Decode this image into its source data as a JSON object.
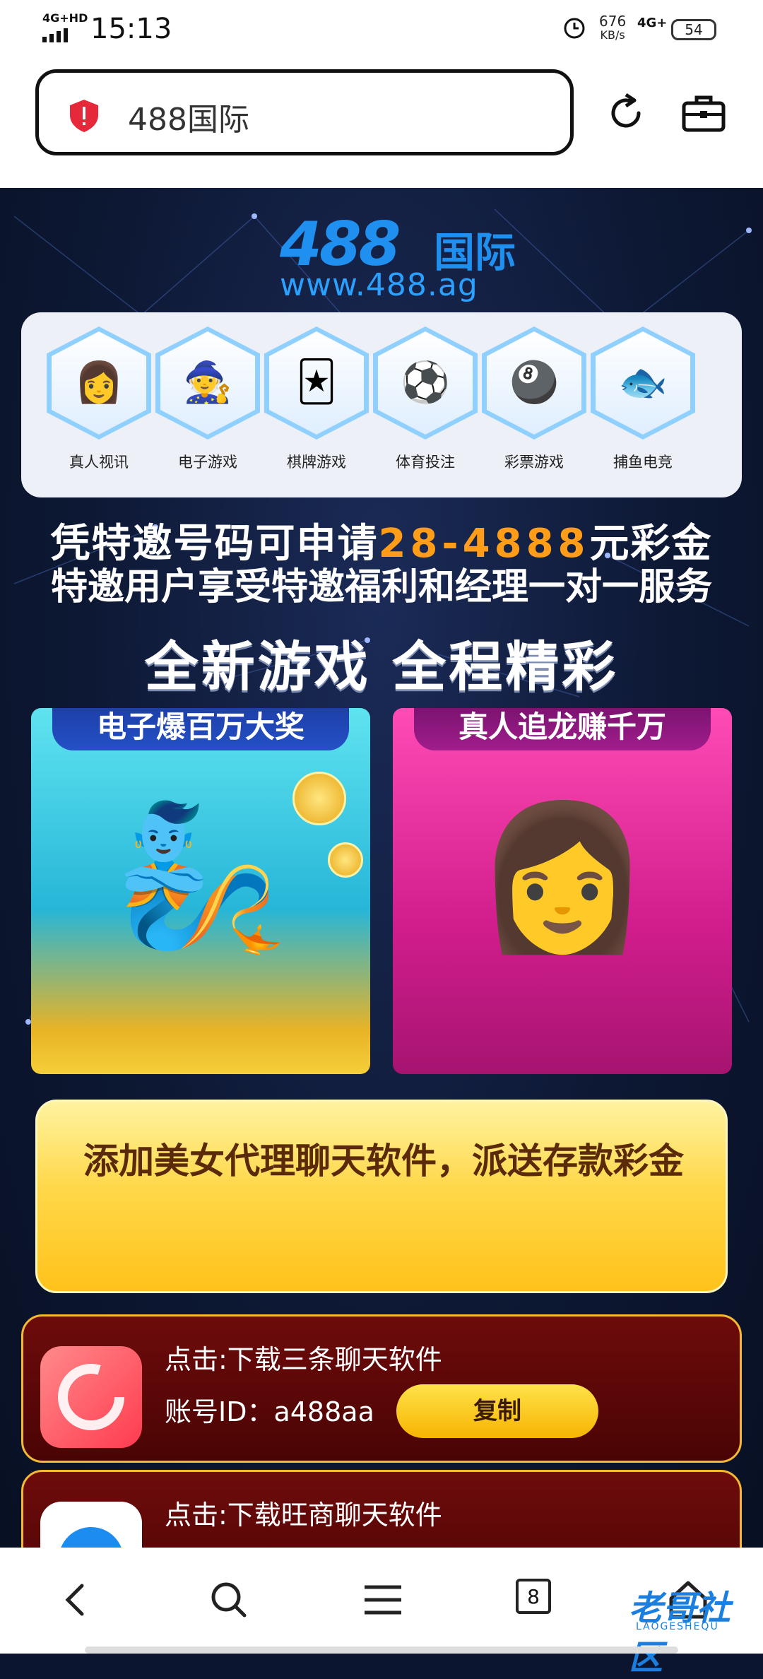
{
  "status_bar": {
    "network_left": "4G+HD",
    "time": "15:13",
    "speed_value": "676",
    "speed_unit": "KB/s",
    "network_right": "4G+",
    "battery": "54"
  },
  "address_bar": {
    "url_text": "488国际"
  },
  "page": {
    "logo": {
      "number": "488",
      "cn": "国际",
      "url": "www.488.ag"
    },
    "categories": [
      {
        "label": "真人视讯",
        "icon": "dealer-icon"
      },
      {
        "label": "电子游戏",
        "icon": "wizard-slot-icon"
      },
      {
        "label": "棋牌游戏",
        "icon": "card-king-icon"
      },
      {
        "label": "体育投注",
        "icon": "sports-icon"
      },
      {
        "label": "彩票游戏",
        "icon": "lottery-icon"
      },
      {
        "label": "捕鱼电竞",
        "icon": "fish-icon"
      }
    ],
    "promo_line1_a": "凭特邀号码可申请",
    "promo_line1_b": "28-4888",
    "promo_line1_c": "元彩金",
    "promo_line2": "特邀用户享受特邀福利和经理一对一服务",
    "slogan": "全新游戏 全程精彩",
    "card_left_title": "电子爆百万大奖",
    "card_right_title": "真人追龙赚千万",
    "yellow_box_text": "添加美女代理聊天软件，派送存款彩金",
    "download_rows": [
      {
        "title": "点击:下载三条聊天软件",
        "account_label": "账号ID：",
        "account_value": "a488aa",
        "copy_label": "复制"
      },
      {
        "title": "点击:下载旺商聊天软件"
      }
    ]
  },
  "nav_bar": {
    "tab_count": "8",
    "watermark": "老哥社区",
    "watermark_sub": "LAOGESHEQU"
  },
  "colors": {
    "accent_blue": "#1f8ff0",
    "promo_orange": "#ff9d18",
    "download_red": "#6e0b0b",
    "gold": "#f7b400"
  }
}
